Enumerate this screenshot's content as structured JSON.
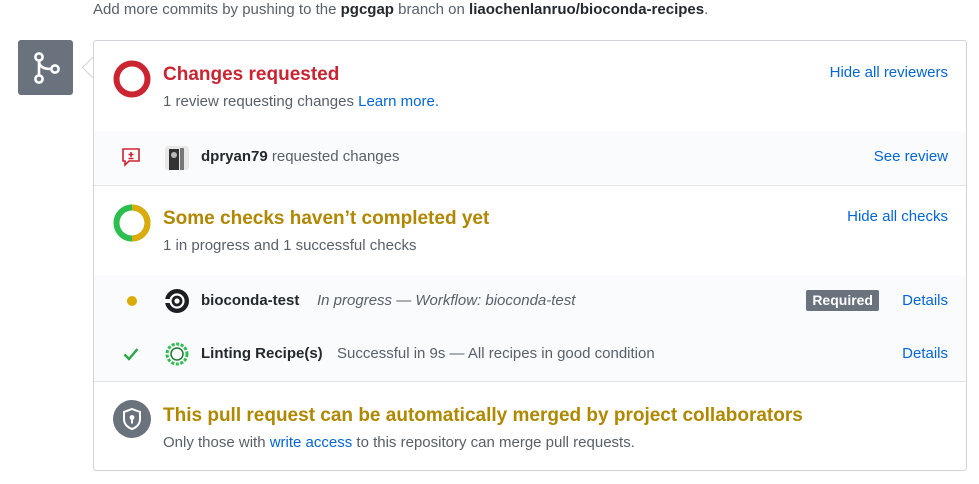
{
  "top_note": {
    "prefix": "Add more commits by pushing to the ",
    "branch": "pgcgap",
    "middle": " branch on ",
    "repo": "liaochenlanruo/bioconda-recipes",
    "suffix": "."
  },
  "reviews": {
    "title": "Changes requested",
    "description": "1 review requesting changes",
    "learn_more": "Learn more.",
    "hide_all": "Hide all reviewers",
    "status_color": "#cb2431",
    "reviewer": {
      "name": "dpryan79",
      "action": "requested changes",
      "see_review": "See review"
    }
  },
  "checks": {
    "title": "Some checks haven’t completed yet",
    "description": "1 in progress and 1 successful checks",
    "hide_all": "Hide all checks",
    "status_color": "#b08800",
    "items": [
      {
        "name": "bioconda-test",
        "status": "In progress — Workflow: bioconda-test",
        "badge": "Required",
        "details": "Details"
      },
      {
        "name": "Linting Recipe(s)",
        "status": "Successful in 9s — All recipes in good condition",
        "details": "Details"
      }
    ]
  },
  "merge": {
    "title": "This pull request can be automatically merged by project collaborators",
    "desc_prefix": "Only those with ",
    "desc_link": "write access",
    "desc_suffix": " to this repository can merge pull requests."
  }
}
